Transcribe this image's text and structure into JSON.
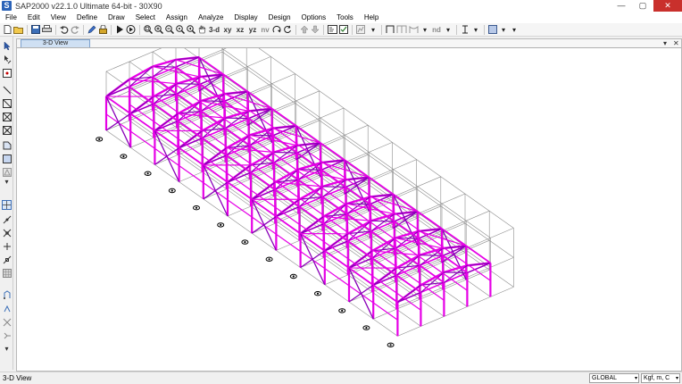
{
  "window": {
    "title": "SAP2000 v22.1.0 Ultimate 64-bit - 30X90",
    "app_icon": "S",
    "minimize_glyph": "—",
    "restore_glyph": "▢",
    "close_glyph": "✕"
  },
  "menu": [
    "File",
    "Edit",
    "View",
    "Define",
    "Draw",
    "Select",
    "Assign",
    "Analyze",
    "Display",
    "Design",
    "Options",
    "Tools",
    "Help"
  ],
  "toolbar": {
    "view_3d": "3-d",
    "view_xy": "xy",
    "view_xz": "xz",
    "view_yz": "yz",
    "view_nv": "nv",
    "view_nd": "nd",
    "icons": [
      "new-file-icon",
      "open-folder-icon",
      "save-icon",
      "print-icon",
      "undo-icon",
      "redo-icon",
      "pencil-icon",
      "lock-icon",
      "run-icon",
      "run-now-icon",
      "zoom-window-icon",
      "zoom-in-icon",
      "zoom-out-icon",
      "zoom-fit-icon",
      "zoom-previous-icon",
      "pan-icon",
      "rotate-3d-icon",
      "refresh-icon",
      "move-up-icon",
      "move-down-icon",
      "set-display-options-icon",
      "show-deformed-icon",
      "frame-draw-icon",
      "frame-section-icon",
      "cable-icon",
      "text-cursor-icon",
      "area-icon"
    ]
  },
  "view": {
    "tab_label": "3-D View",
    "tab_dropdown": "▾",
    "tab_close": "✕",
    "model_colors": {
      "frame_members": "#e600e6",
      "frame_members_dark": "#8a00b8",
      "grid_lines": "#8c8c8c",
      "joints": "#000000",
      "background": "#ffffff"
    }
  },
  "status": {
    "text": "3-D View",
    "coord_system": "GLOBAL",
    "units": "Kgf, m, C"
  },
  "left_toolbar_icons": [
    "pointer-icon",
    "reshape-icon",
    "select-joint-icon",
    "draw-frame-icon",
    "draw-diagonal-icon",
    "draw-cross-brace-icon",
    "draw-cable-icon",
    "draw-area-icon",
    "draw-rectangular-area-icon",
    "draw-poly-icon",
    "snap-joints-icon",
    "snap-lines-icon",
    "snap-intersection-icon",
    "snap-perpendicular-icon",
    "snap-midpoint-icon",
    "snap-grid-icon",
    "select-all-icon",
    "get-previous-icon",
    "clear-selection-icon",
    "intersect-icon"
  ]
}
